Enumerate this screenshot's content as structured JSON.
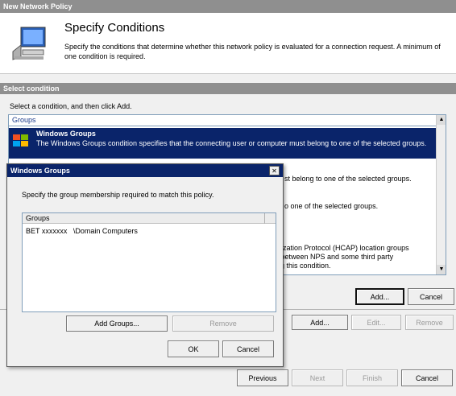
{
  "window": {
    "title": "New Network Policy",
    "heading": "Specify Conditions",
    "description": "Specify the conditions that determine whether this network policy is evaluated for a connection request. A minimum of one condition is required."
  },
  "select_condition": {
    "title": "Select condition",
    "instruction": "Select a condition, and then click Add.",
    "group_header": "Groups",
    "selected_item": {
      "title": "Windows Groups",
      "description": "The Windows Groups condition specifies that the connecting user or computer must belong to one of the selected groups."
    },
    "partial_texts": [
      "st belong to one of the selected groups.",
      "o one of the selected groups.",
      "orization Protocol (HCAP) location groups",
      "n between NPS and some third party",
      "ing this condition."
    ],
    "buttons": {
      "add": "Add...",
      "cancel": "Cancel"
    }
  },
  "lower_buttons": {
    "add": "Add...",
    "edit": "Edit...",
    "remove": "Remove"
  },
  "wizard_buttons": {
    "previous": "Previous",
    "next": "Next",
    "finish": "Finish",
    "cancel": "Cancel"
  },
  "dialog": {
    "title": "Windows Groups",
    "close": "✕",
    "instruction": "Specify the group membership required to match this policy.",
    "column_header": "Groups",
    "groups": [
      "BET xxxxxxx   \\Domain Computers"
    ],
    "buttons": {
      "add_groups": "Add Groups...",
      "remove": "Remove",
      "ok": "OK",
      "cancel": "Cancel"
    }
  },
  "colors": {
    "selection": "#0a246a",
    "titlebar": "#8f8f8f",
    "dialog_title": "#0a246a"
  }
}
